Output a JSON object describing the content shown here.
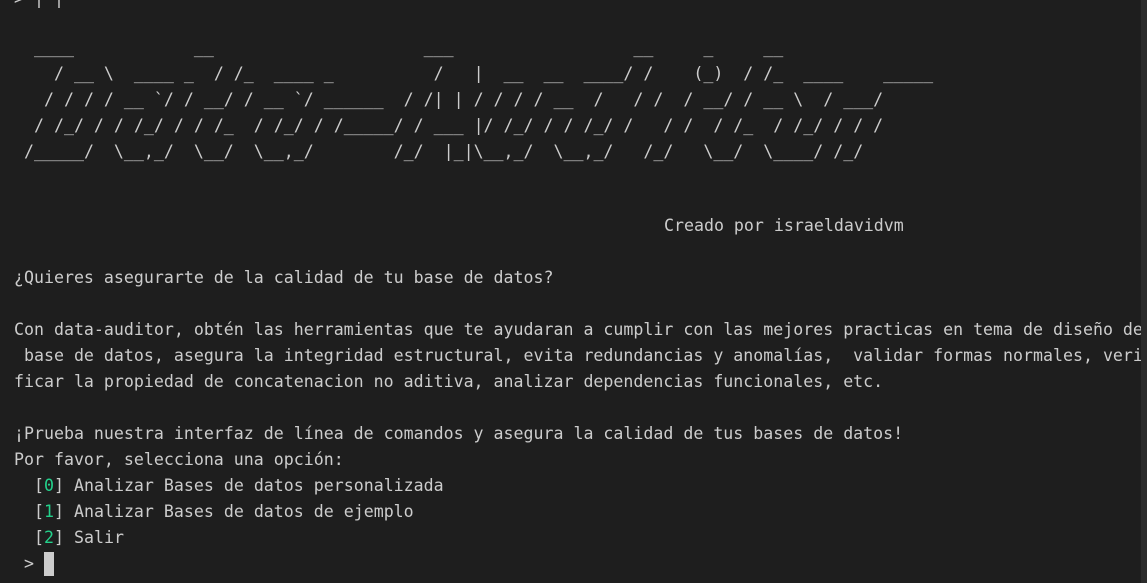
{
  "terminal": {
    "top_fragment": "> | |",
    "banner_lines": [
      " ____            __                     ___                  __     _     __",
      "   / __ \\  ____ _  / /_  ____ _          /   |  __  __  ____/ /    (_)  / /_  ____    _____",
      "  / / / / __ `/ / __/ / __ `/ ______  / /| | / / / / __  /   / /  / __/ / __ \\  / ___/",
      " / /_/ / / /_/ / / /_  / /_/ / /_____/ / ___ |/ /_/ / / /_/ /   / /  / /_  / /_/ / / /",
      "/_____/  \\__,_/  \\__/  \\__,_/        /_/  |_|\\__,_/  \\__,_/   /_/   \\__/  \\____/ /_/"
    ],
    "credit": "Creado por israeldavidvm",
    "question": "¿Quieres asegurarte de la calidad de tu base de datos?",
    "description_lines": [
      "Con data-auditor, obtén las herramientas que te ayudaran a cumplir con las mejores practicas en tema de diseño de",
      " base de datos, asegura la integridad estructural, evita redundancias y anomalías,  validar formas normales, veri",
      "ficar la propiedad de concatenacion no aditiva, analizar dependencias funcionales, etc."
    ],
    "call_to_action": "¡Prueba nuestra interfaz de línea de comandos y asegura la calidad de tus bases de datos!",
    "select_prompt": "Por favor, selecciona una opción:",
    "options": [
      {
        "open": "[",
        "index": "0",
        "close": "]",
        "label": " Analizar Bases de datos personalizada"
      },
      {
        "open": "[",
        "index": "1",
        "close": "]",
        "label": " Analizar Bases de datos de ejemplo"
      },
      {
        "open": "[",
        "index": "2",
        "close": "]",
        "label": " Salir"
      }
    ],
    "input_prompt": ">",
    "bottom_fragment": "",
    "colors": {
      "background": "#1e1e1e",
      "foreground": "#cccccc",
      "option_index": "#23d18b"
    }
  }
}
